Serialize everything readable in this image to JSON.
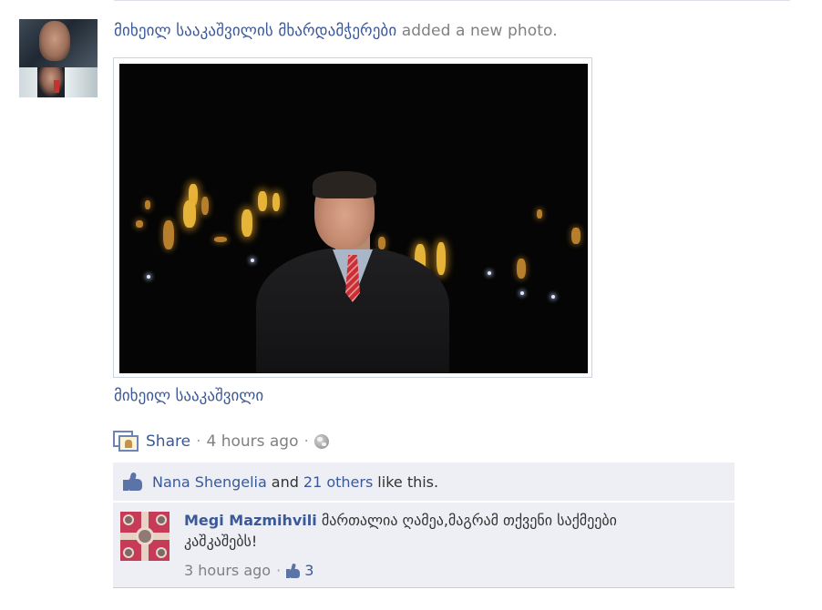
{
  "post": {
    "author": "მიხეილ სააკაშვილის მხარდამჭერები",
    "action_text": "added a new photo.",
    "photo_caption": "მიხეილ სააკაშვილი"
  },
  "actions": {
    "share_label": "Share",
    "separator": "·",
    "timestamp": "4 hours ago",
    "privacy_icon": "globe-icon"
  },
  "likes": {
    "first_liker": "Nana Shengelia",
    "and_text": "and",
    "others_link": "21 others",
    "suffix": "like this."
  },
  "comments": [
    {
      "author": "Megi Mazmihvili",
      "text": "მართალია ღამეა,მაგრამ თქვენი საქმეები კაშკაშებს!",
      "timestamp": "3 hours ago",
      "separator": "·",
      "like_count": "3"
    }
  ],
  "colors": {
    "link": "#3b5998",
    "muted": "#808080",
    "ufi_background": "#edeff4"
  }
}
